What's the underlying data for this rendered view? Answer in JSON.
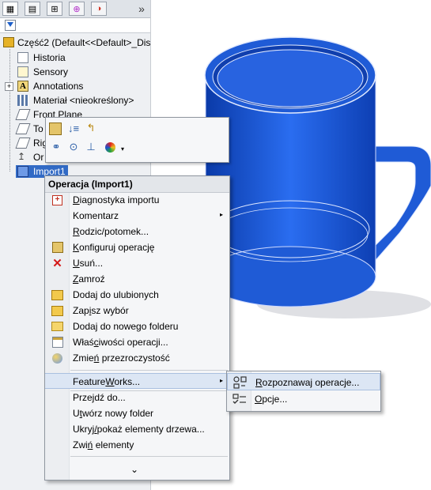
{
  "colors": {
    "model_blue": "#1f5bd6",
    "selection": "#316ac5",
    "menu_bg": "#f5f6f8",
    "panel_bg": "#eef0f3"
  },
  "tabs": [
    {
      "icon": "feature-manager-icon"
    },
    {
      "icon": "property-manager-icon"
    },
    {
      "icon": "configuration-manager-icon"
    },
    {
      "icon": "dimxpert-icon"
    },
    {
      "icon": "display-manager-icon"
    }
  ],
  "expand_label": "»",
  "tree": {
    "root_label": "Część2  (Default<<Default>_Dis",
    "nodes": [
      {
        "label": "Historia",
        "icon": "history-icon"
      },
      {
        "label": "Sensory",
        "icon": "sensor-icon"
      },
      {
        "label": "Annotations",
        "icon": "annotations-icon"
      },
      {
        "label": "Materiał <nieokreślony>",
        "icon": "material-icon"
      },
      {
        "label": "Front Plane",
        "icon": "plane-icon"
      },
      {
        "label": "To",
        "icon": "plane-icon"
      },
      {
        "label": "Rig",
        "icon": "plane-icon"
      },
      {
        "label": "Or",
        "icon": "origin-icon"
      },
      {
        "label": "Import1",
        "icon": "import-feature-icon"
      }
    ]
  },
  "context_menu": {
    "title": "Operacja (Import1)",
    "items": [
      {
        "pre": "",
        "acc": "D",
        "post": "iagnostyka importu",
        "icon": "diagnostics-icon"
      },
      {
        "pre": "Komentarz",
        "acc": "",
        "post": "",
        "icon": "",
        "submenu": true
      },
      {
        "pre": "",
        "acc": "R",
        "post": "odzic/potomek...",
        "icon": ""
      },
      {
        "pre": "",
        "acc": "K",
        "post": "onfiguruj operację",
        "icon": "configure-icon"
      },
      {
        "pre": "",
        "acc": "U",
        "post": "suń...",
        "icon": "delete-icon"
      },
      {
        "pre": "",
        "acc": "Z",
        "post": "amroź",
        "icon": ""
      },
      {
        "pre": "Dodaj do ulubionych",
        "acc": "",
        "post": "",
        "icon": "favorites-icon"
      },
      {
        "pre": "Zap",
        "acc": "i",
        "post": "sz wybór",
        "icon": "save-selection-icon"
      },
      {
        "pre": "Dodaj do nowego folderu",
        "acc": "",
        "post": "",
        "icon": "folder-icon"
      },
      {
        "pre": "Właś",
        "acc": "c",
        "post": "iwości operacji...",
        "icon": "properties-icon"
      },
      {
        "pre": "Zmie",
        "acc": "ń",
        "post": " przezroczystość",
        "icon": "transparency-icon"
      },
      {
        "pre": "Feature",
        "acc": "W",
        "post": "orks...",
        "icon": "",
        "submenu": true
      },
      {
        "pre": "Przejdź do...",
        "acc": "",
        "post": "",
        "icon": ""
      },
      {
        "pre": "U",
        "acc": "t",
        "post": "wórz nowy folder",
        "icon": ""
      },
      {
        "pre": "Ukryj",
        "acc": "/",
        "post": "pokaż elementy drzewa...",
        "icon": ""
      },
      {
        "pre": "Zwi",
        "acc": "ń",
        "post": " elementy",
        "icon": ""
      }
    ],
    "more_label": "⌄"
  },
  "submenu": {
    "items": [
      {
        "pre": "",
        "acc": "R",
        "post": "ozpoznawaj operacje...",
        "icon": "recognize-features-icon"
      },
      {
        "pre": "",
        "acc": "O",
        "post": "pcje...",
        "icon": "options-icon"
      }
    ]
  }
}
